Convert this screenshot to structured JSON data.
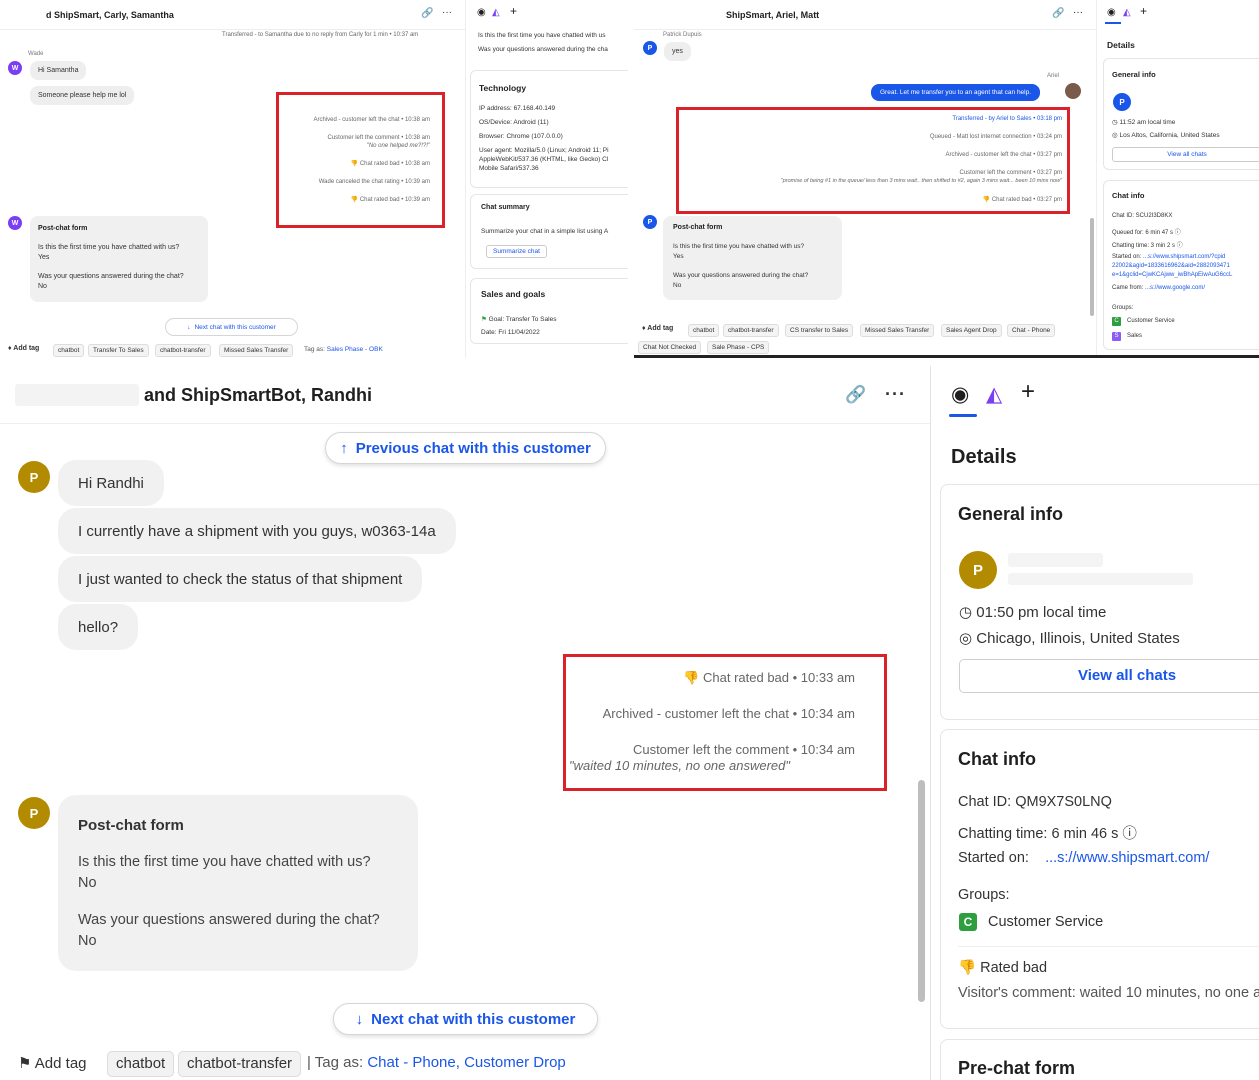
{
  "colors": {
    "accent": "#1a56e8",
    "highlight_red": "#d9222a",
    "avatar_gold": "#b38b00",
    "avatar_purple": "#7b3ff2",
    "group_green": "#2e9e3e",
    "group_purple": "#8b5cf6"
  },
  "panel1": {
    "title": "d ShipSmart, Carly, Samantha",
    "transfer_note": "Transferred - to Samantha due to no reply from Carly for 1 min • 10:37 am",
    "sender_name": "Wade",
    "avatar_letter": "W",
    "messages": [
      "Hi Samantha",
      "Someone please help me lol"
    ],
    "events": [
      "Archived - customer left the chat • 10:38 am",
      "Customer left the comment • 10:38 am",
      "\"No one helped me?!?!\"",
      "Chat rated bad • 10:38 am",
      "Wade canceled the chat rating • 10:39 am",
      "Chat rated bad • 10:39 am"
    ],
    "postchat": {
      "title": "Post-chat form",
      "q1": "Is this the first time you have chatted with us?",
      "a1": "Yes",
      "q2": "Was your questions answered during the chat?",
      "a2": "No"
    },
    "next_chat": "Next chat with this customer",
    "add_tag": "Add tag",
    "tags": [
      "chatbot",
      "Transfer To Sales",
      "chatbot-transfer",
      "Missed Sales Transfer"
    ],
    "tag_as_label": "Tag as:",
    "tag_as_value": "Sales Phase - OBK",
    "side": {
      "q1": "Is this the first time you have chatted with us",
      "q2": "Was your questions answered during the cha",
      "tech_title": "Technology",
      "ip": "IP address: 67.168.40.149",
      "os": "OS/Device: Android (11)",
      "browser": "Browser: Chrome (107.0.0.0)",
      "ua1": "User agent: Mozilla/5.0 (Linux; Android 11; Pi",
      "ua2": "AppleWebKit/537.36 (KHTML, like Gecko) Cl",
      "ua3": "Mobile Safari/537.36",
      "summary_title": "Chat summary",
      "summary_text": "Summarize your chat in a simple list using A",
      "summary_btn": "Summarize chat",
      "goals_title": "Sales and goals",
      "goal": "Goal: Transfer To Sales",
      "date": "Date: Fri 11/04/2022"
    }
  },
  "panel2": {
    "title": "ShipSmart, Ariel, Matt",
    "sender_name": "Patrick Dupuis",
    "avatar_letter": "P",
    "customer_msg": "yes",
    "agent_name": "Ariel",
    "agent_msg": "Great. Let me transfer you to an agent that can help.",
    "events": [
      "Transferred - by Ariel to Sales • 03:18 pm",
      "Queued - Matt lost internet connection • 03:24 pm",
      "Archived - customer left the chat • 03:27 pm",
      "Customer left the comment • 03:27 pm",
      "\"promise of being #1 in the queue/ less than 3 mins wait.. then shifted to #2, again 3 mins wait... been 10 mins now\"",
      "Chat rated bad • 03:27 pm"
    ],
    "postchat": {
      "title": "Post-chat form",
      "q1": "Is this the first time you have chatted with us?",
      "a1": "Yes",
      "q2": "Was your questions answered during the chat?",
      "a2": "No"
    },
    "add_tag": "Add tag",
    "tags": [
      "chatbot",
      "chatbot-transfer",
      "CS transfer to Sales",
      "Missed Sales Transfer",
      "Sales Agent Drop",
      "Chat - Phone",
      "Chat Not Checked",
      "Sale Phase - CPS"
    ],
    "side": {
      "details": "Details",
      "general": "General info",
      "local_time": "11:52 am local time",
      "location": "Los Altos, California, United States",
      "view_all": "View all chats",
      "chat_info": "Chat info",
      "chat_id": "Chat ID: SCU2I3D8KX",
      "queued": "Queued for: 6 min 47 s",
      "chatting": "Chatting time: 3 min 2 s",
      "started_label": "Started on:",
      "started_val": "...s://www.shipsmart.com/?cpid",
      "started_val2": "22002&agid=1833616962&aid=2882093471",
      "started_val3": "e=1&gclid=CjwKCAjww_iwBhApEiwAuG6ccL",
      "came_label": "Came from:",
      "came_val": "...s://www.google.com/",
      "groups": "Groups:",
      "group1": "Customer Service",
      "group1_letter": "C",
      "group2": "Sales",
      "group2_letter": "S"
    }
  },
  "main": {
    "title": "and ShipSmartBot, Randhi",
    "prev_chat": "Previous chat with this customer",
    "avatar_letter": "P",
    "messages": [
      "Hi Randhi",
      "I currently have a shipment with you guys, w0363-14a",
      "I just wanted to check the status of that shipment",
      "hello?"
    ],
    "events": {
      "rated": "Chat rated bad",
      "rated_time": "10:33 am",
      "archived": "Archived - customer left the chat",
      "archived_time": "10:34 am",
      "comment": "Customer left the comment",
      "comment_time": "10:34 am",
      "quote": "\"waited 10 minutes, no one answered\""
    },
    "postchat": {
      "title": "Post-chat form",
      "q1": "Is this the first time you have chatted with us?",
      "a1": "No",
      "q2": "Was your questions answered during the chat?",
      "a2": "No"
    },
    "next_chat": "Next chat with this customer",
    "add_tag": "Add tag",
    "tags": [
      "chatbot",
      "chatbot-transfer"
    ],
    "tag_as_label": "Tag as:",
    "tag_as_value": "Chat - Phone, Customer Drop"
  },
  "details": {
    "heading": "Details",
    "general_title": "General info",
    "avatar_letter": "P",
    "local_time": "01:50 pm local time",
    "location": "Chicago, Illinois, United States",
    "view_all": "View all chats",
    "chat_info_title": "Chat info",
    "chat_id": "Chat ID: QM9X7S0LNQ",
    "chatting_time": "Chatting time: 6 min 46 s",
    "started_label": "Started on:",
    "started_value": "...s://www.shipsmart.com/",
    "groups_label": "Groups:",
    "group_letter": "C",
    "group_name": "Customer Service",
    "rated": "Rated bad",
    "visitor_comment_label": "Visitor's comment:",
    "visitor_comment": "waited 10 minutes, no one a",
    "prechat_title": "Pre-chat form"
  }
}
